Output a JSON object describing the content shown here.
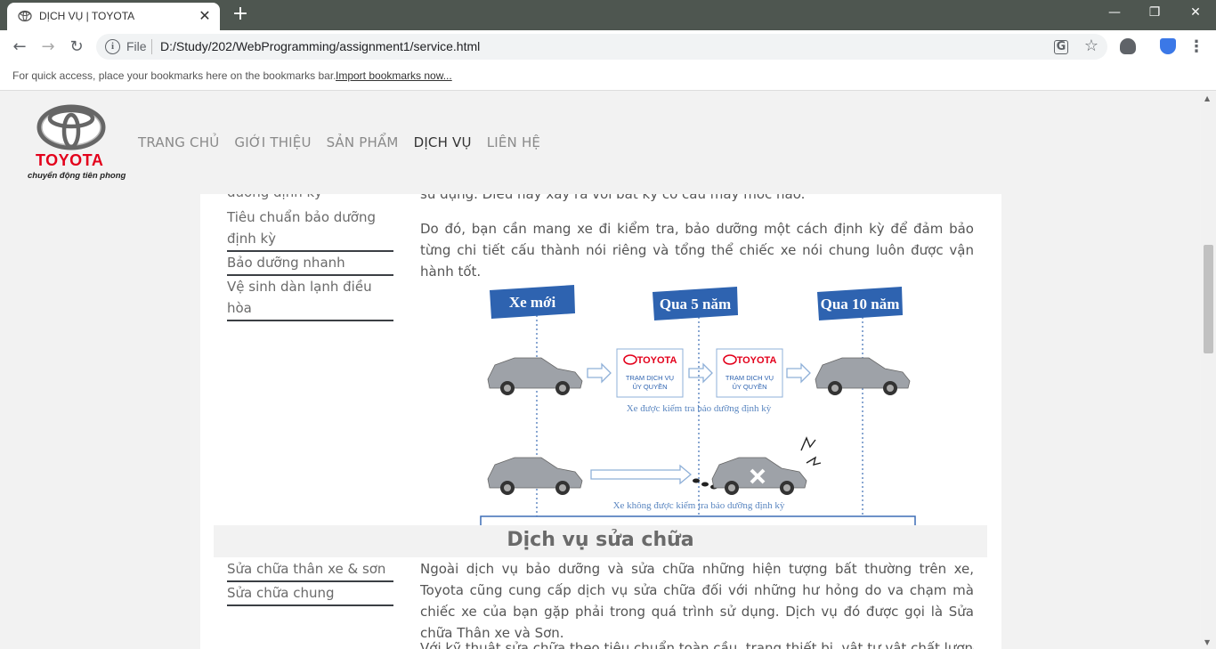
{
  "browser": {
    "tab_title": "DỊCH VỤ | TOYOTA",
    "tab_close": "✕",
    "new_tab": "+",
    "window_controls": [
      "—",
      "❐",
      "✕"
    ],
    "back": "←",
    "forward": "→",
    "reload": "↻",
    "info_glyph": "i",
    "scheme": "File",
    "url": "D:/Study/202/WebProgramming/assignment1/service.html",
    "translate_icon": "G",
    "star_icon": "☆",
    "menu_icon": "⋮",
    "bookmarks_hint": "For quick access, place your bookmarks here on the bookmarks bar.",
    "import_bookmarks": "Import bookmarks now...",
    "extension_colors": [
      "#5f6368",
      "#3b78e7"
    ]
  },
  "header": {
    "logo_word": "TOYOTA",
    "logo_tagline": "chuyển động tiên phong",
    "nav": [
      "TRANG CHỦ",
      "GIỚI THIỆU",
      "SẢN PHẨM",
      "DỊCH VỤ",
      "LIÊN HỆ"
    ],
    "active_nav": "DỊCH VỤ",
    "brand_color": "#e3001b"
  },
  "sidebar_top": {
    "cut_item": "dưỡng định kỳ",
    "items": [
      "Tiêu chuẩn bảo dưỡng định kỳ",
      "Bảo dưỡng nhanh",
      "Vệ sinh dàn lạnh điều hòa"
    ]
  },
  "main_top": {
    "cut_line": "sử dụng. Điều này xảy ra với bất kỳ cỗ cấu máy móc nào.",
    "paragraph": "Do đó, bạn cần mang xe đi kiểm tra, bảo dưỡng một cách định kỳ để đảm bảo từng chi tiết cấu thành nói riêng và tổng thể chiếc xe nói chung luôn được vận hành tốt."
  },
  "figure": {
    "labels": [
      "Xe mới",
      "Qua 5 năm",
      "Qua 10 năm"
    ],
    "station_brand": "TOYOTA",
    "station_text_1": "TRẠM DỊCH VỤ",
    "station_text_2": "ỦY QUYỀN",
    "caption_good": "Xe được kiểm tra bảo dưỡng định kỳ",
    "caption_bad": "Xe không được kiểm tra bảo dưỡng định kỳ"
  },
  "section": {
    "title": "Dịch vụ sửa chữa"
  },
  "sidebar_bottom": {
    "items": [
      "Sửa chữa thân xe & sơn",
      "Sửa chữa chung"
    ]
  },
  "main_bottom": {
    "paragraph": "Ngoài dịch vụ bảo dưỡng và sửa chữa những hiện tượng bất thường trên xe, Toyota cũng cung cấp dịch vụ sửa chữa đối với những hư hỏng do va chạm mà chiếc xe của bạn gặp phải trong quá trình sử dụng. Dịch vụ đó được gọi là Sửa chữa Thân xe và Sơn.",
    "cut_line": "Với kỹ thuật sửa chữa theo tiêu chuẩn toàn cầu, trang thiết bị, vật tư vật chất lượng cao"
  }
}
